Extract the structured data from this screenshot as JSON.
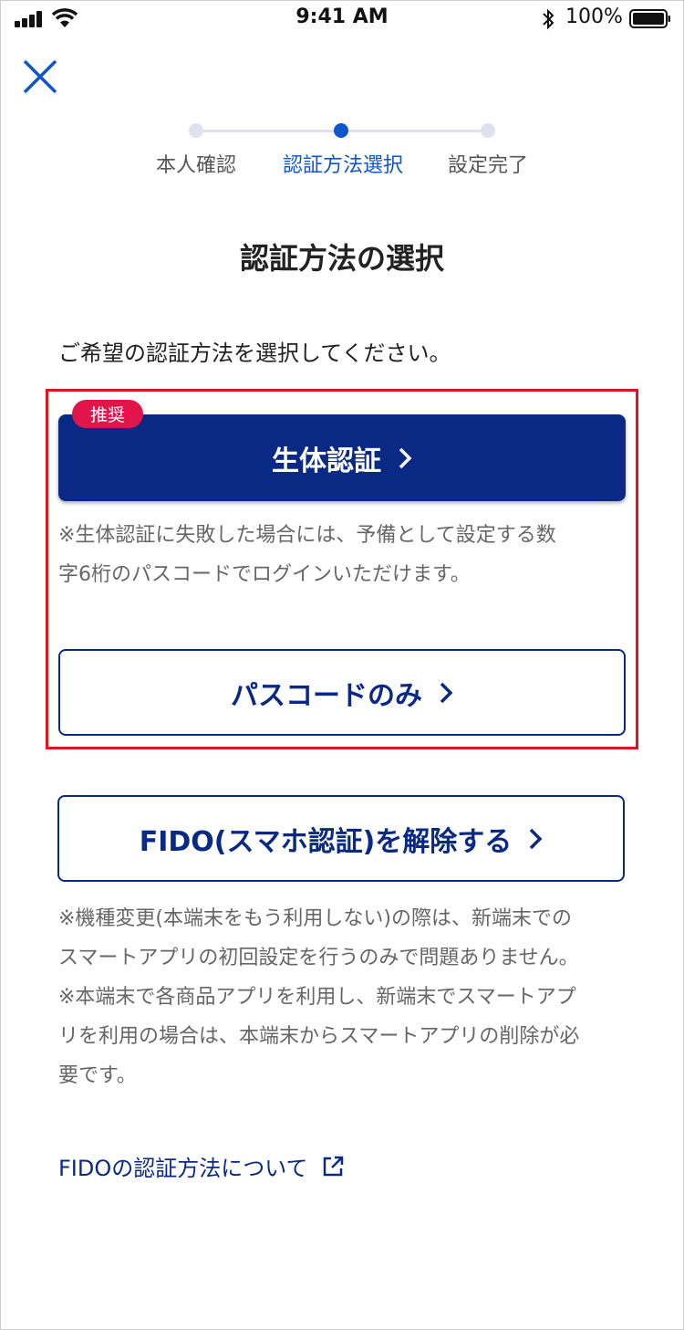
{
  "status_bar": {
    "time": "9:41 AM",
    "battery": "100%",
    "icons": [
      "signal-icon",
      "wifi-icon",
      "bluetooth-icon",
      "battery-icon"
    ]
  },
  "header": {
    "close_icon": "close-icon"
  },
  "stepper": {
    "steps": [
      {
        "label": "本人確認",
        "active": false
      },
      {
        "label": "認証方法選択",
        "active": true
      },
      {
        "label": "設定完了",
        "active": false
      }
    ]
  },
  "title": "認証方法の選択",
  "instruction": "ご希望の認証方法を選択してください。",
  "biometric": {
    "badge": "推奨",
    "label": "生体認証",
    "note_lines": [
      "※生体認証に失敗した場合には、予備として設定する数",
      "字6桁のパスコードでログインいただけます。"
    ]
  },
  "passcode": {
    "label": "パスコードのみ"
  },
  "fido_release": {
    "label": "FIDO(スマホ認証)を解除する",
    "note_lines": [
      "※機種変更(本端末をもう利用しない)の際は、新端末での",
      "スマートアプリの初回設定を行うのみで問題ありません。",
      "※本端末で各商品アプリを利用し、新端末でスマートアプ",
      "リを利用の場合は、本端末からスマートアプリの削除が必",
      "要です。"
    ]
  },
  "about_link": {
    "label": "FIDOの認証方法について"
  },
  "colors": {
    "primary": "#0a2985",
    "accent_blue": "#0e56c9",
    "badge": "#e0164b",
    "highlight": "#e0141e"
  }
}
